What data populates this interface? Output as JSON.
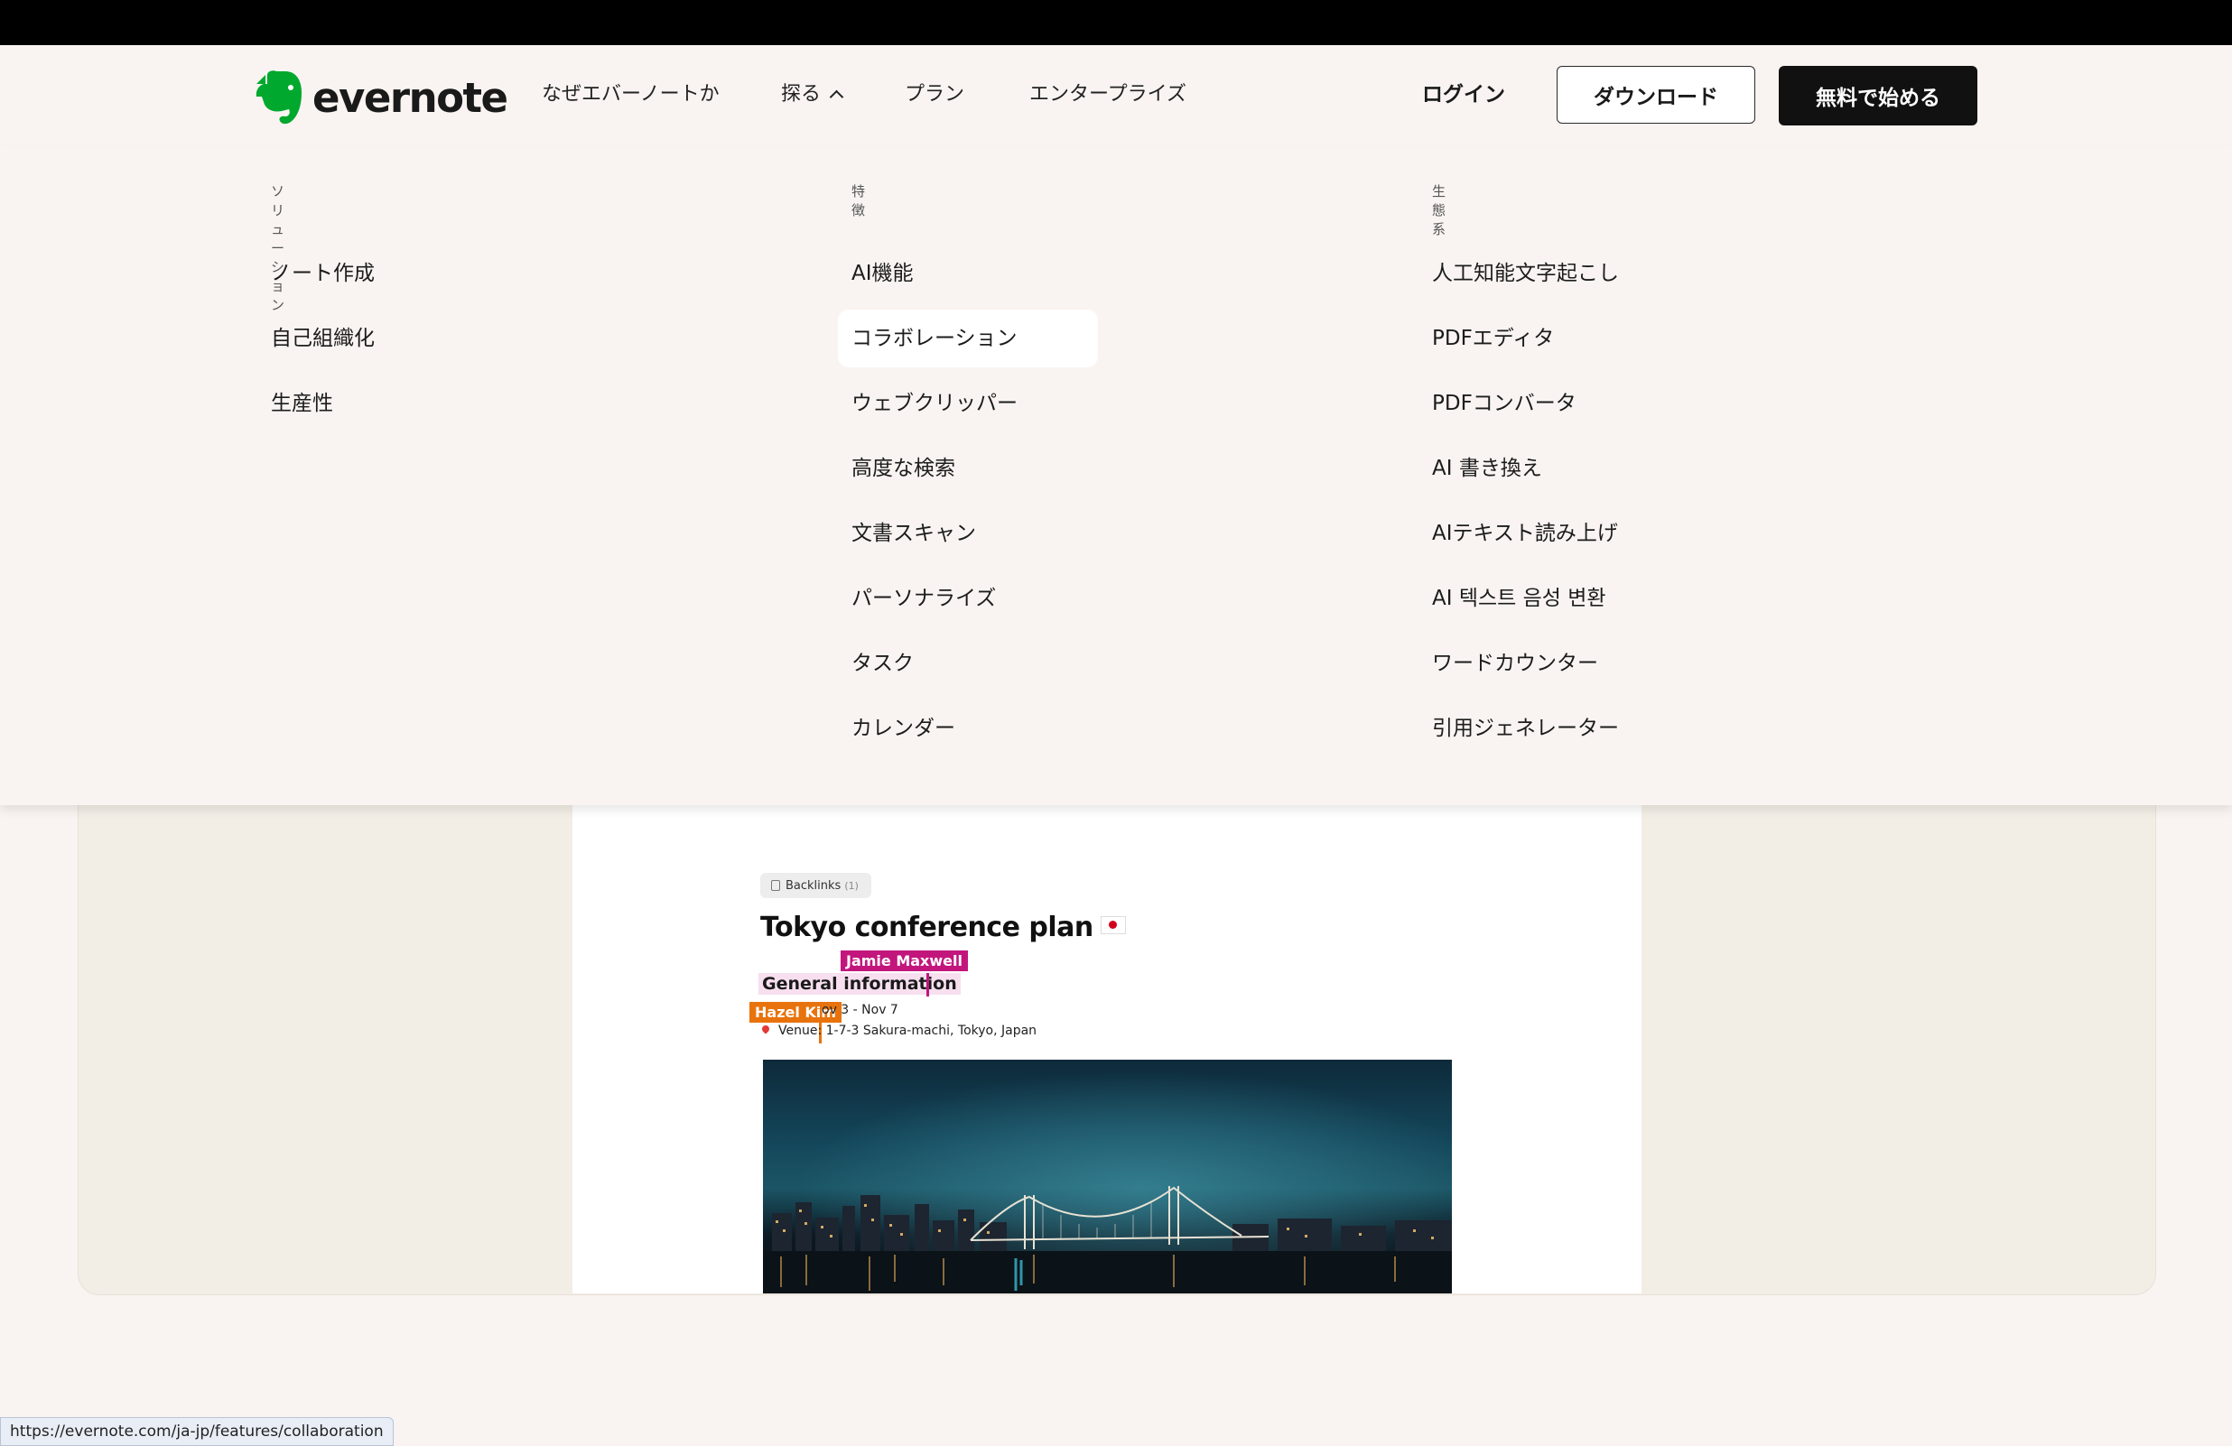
{
  "header": {
    "logo_text": "evernote",
    "nav": {
      "why": "なぜエバーノートか",
      "explore": "探る",
      "plans": "プラン",
      "enterprise": "エンタープライズ"
    },
    "login": "ログイン",
    "download": "ダウンロード",
    "start_free": "無料で始める"
  },
  "menu": {
    "solutions": {
      "heading": "ソリューション",
      "items": [
        "ノート作成",
        "自己組織化",
        "生産性"
      ]
    },
    "features": {
      "heading": "特徴",
      "items": [
        "AI機能",
        "コラボレーション",
        "ウェブクリッパー",
        "高度な検索",
        "文書スキャン",
        "パーソナライズ",
        "タスク",
        "カレンダー"
      ],
      "highlighted_index": 1
    },
    "ecosystem": {
      "heading": "生態系",
      "items": [
        "人工知能文字起こし",
        "PDFエディタ",
        "PDFコンバータ",
        "AI 書き換え",
        "AIテキスト読み上げ",
        "AI 텍스트 음성 변환",
        "ワードカウンター",
        "引用ジェネレーター"
      ]
    }
  },
  "doc": {
    "backlinks_label": "Backlinks",
    "backlinks_count": "(1)",
    "title": "Tokyo conference plan",
    "collaborator_1": "Jamie Maxwell",
    "collaborator_2": "Hazel Kim",
    "heading": "General information",
    "date": "ov 3 - Nov 7",
    "venue_label": "Venue:",
    "venue_value": "1-7-3 Sakura-machi, Tokyo, Japan"
  },
  "status_url": "https://evernote.com/ja-jp/features/collaboration",
  "colors": {
    "accent_green": "#00a82d",
    "jamie_tag": "#c2167d",
    "hazel_tag": "#e8730c",
    "primary_button": "#111111"
  }
}
